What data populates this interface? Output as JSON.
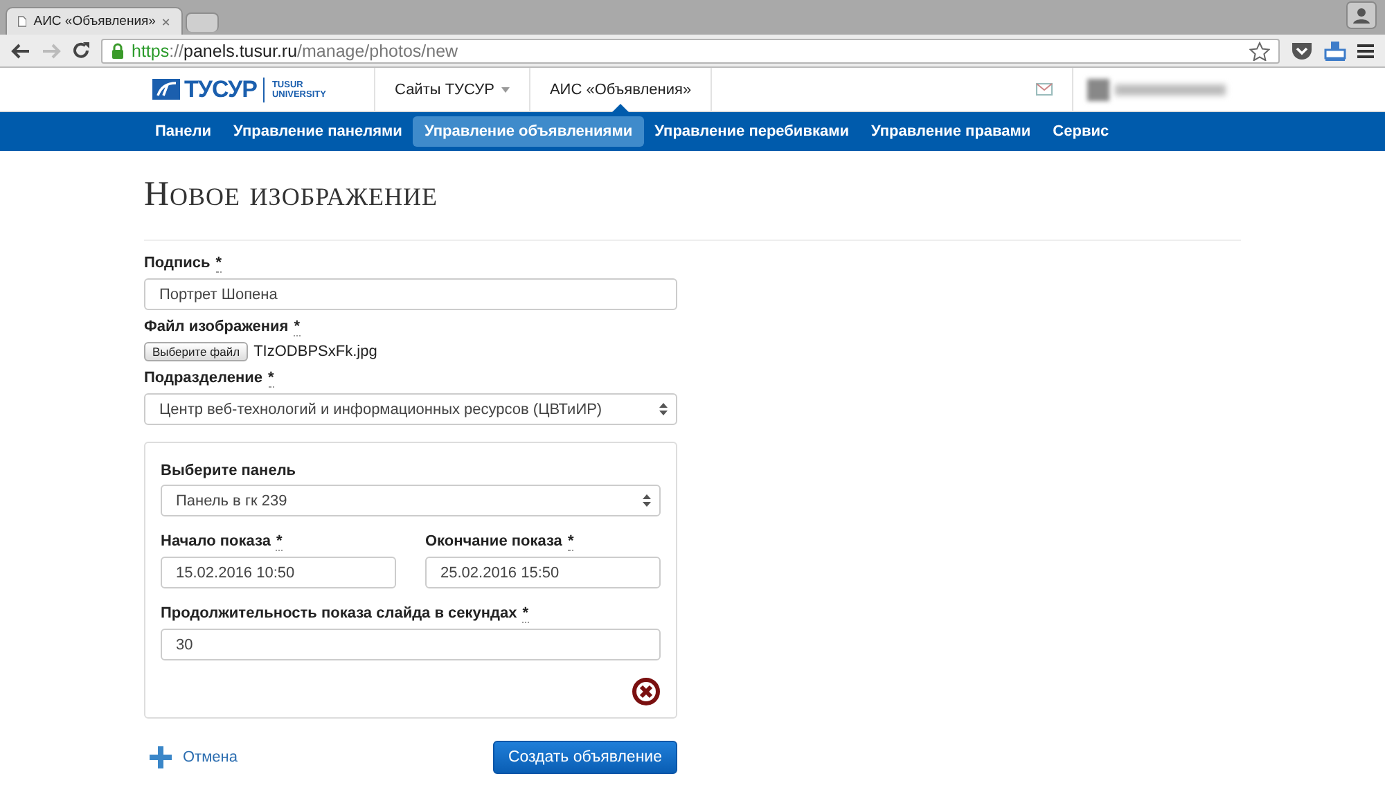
{
  "browser": {
    "tabs": [
      {
        "title": "АИС «Объявления»",
        "selected": true
      }
    ],
    "url": {
      "scheme": "https",
      "separator": "://",
      "host": "panels.tusur.ru",
      "path": "/manage/photos/new"
    }
  },
  "header": {
    "logo": {
      "wordmark": "ТУСУР",
      "line1": "TUSUR",
      "line2": "UNIVERSITY"
    },
    "links": [
      {
        "label": "Сайты ТУСУР",
        "kind": "dropdown",
        "selected": false
      },
      {
        "label": "АИС «Объявления»",
        "kind": "link",
        "selected": true
      }
    ]
  },
  "nav": [
    {
      "label": "Панели",
      "selected": false
    },
    {
      "label": "Управление панелями",
      "selected": false
    },
    {
      "label": "Управление объявлениями",
      "selected": true
    },
    {
      "label": "Управление перебивками",
      "selected": false
    },
    {
      "label": "Управление правами",
      "selected": false
    },
    {
      "label": "Сервис",
      "selected": false
    }
  ],
  "page_title": "Новое изображение",
  "form": {
    "caption": {
      "label": "Подпись",
      "required_mark": "*",
      "value": "Портрет Шопена"
    },
    "file": {
      "label": "Файл изображения",
      "required_mark": "*",
      "button": "Выберите файл",
      "filename": "TIzODBPSxFk.jpg"
    },
    "division": {
      "label": "Подразделение",
      "required_mark": "*",
      "value": "Центр веб-технологий и информационных ресурсов (ЦВТиИР)"
    },
    "panel_block": {
      "panel": {
        "label": "Выберите панель",
        "value": "Панель в гк 239"
      },
      "start": {
        "label": "Начало показа",
        "required_mark": "*",
        "value": "15.02.2016 10:50"
      },
      "end": {
        "label": "Окончание показа",
        "required_mark": "*",
        "value": "25.02.2016 15:50"
      },
      "duration": {
        "label": "Продолжительность показа слайда в секундах",
        "required_mark": "*",
        "value": "30"
      }
    },
    "cancel": "Отмена",
    "submit": "Создать объявление"
  }
}
